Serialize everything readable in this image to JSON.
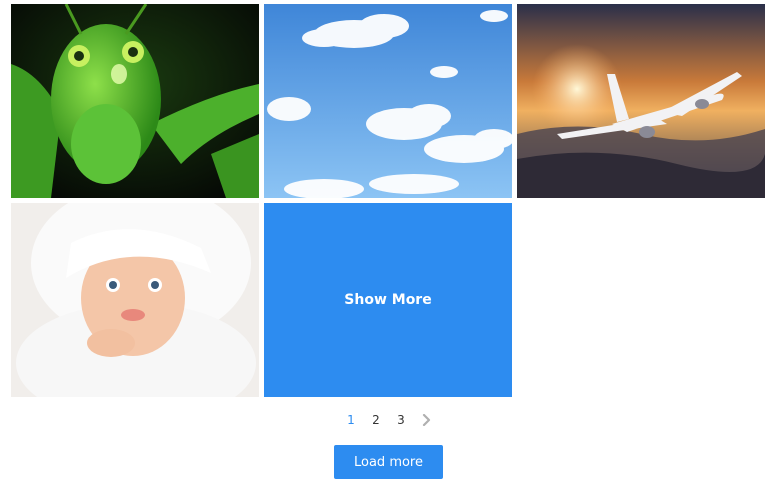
{
  "gallery": {
    "images": [
      {
        "subject": "grasshopper-image"
      },
      {
        "subject": "sky-clouds-image"
      },
      {
        "subject": "airplane-sunset-image"
      },
      {
        "subject": "baby-towel-image"
      }
    ],
    "show_more_label": "Show More"
  },
  "pagination": {
    "pages": [
      "1",
      "2",
      "3"
    ],
    "active_page": "1",
    "next_icon": "chevron-right-icon"
  },
  "load_more_label": "Load more",
  "colors": {
    "accent": "#2d8cf0",
    "inactive_icon": "#b0b0b0"
  }
}
